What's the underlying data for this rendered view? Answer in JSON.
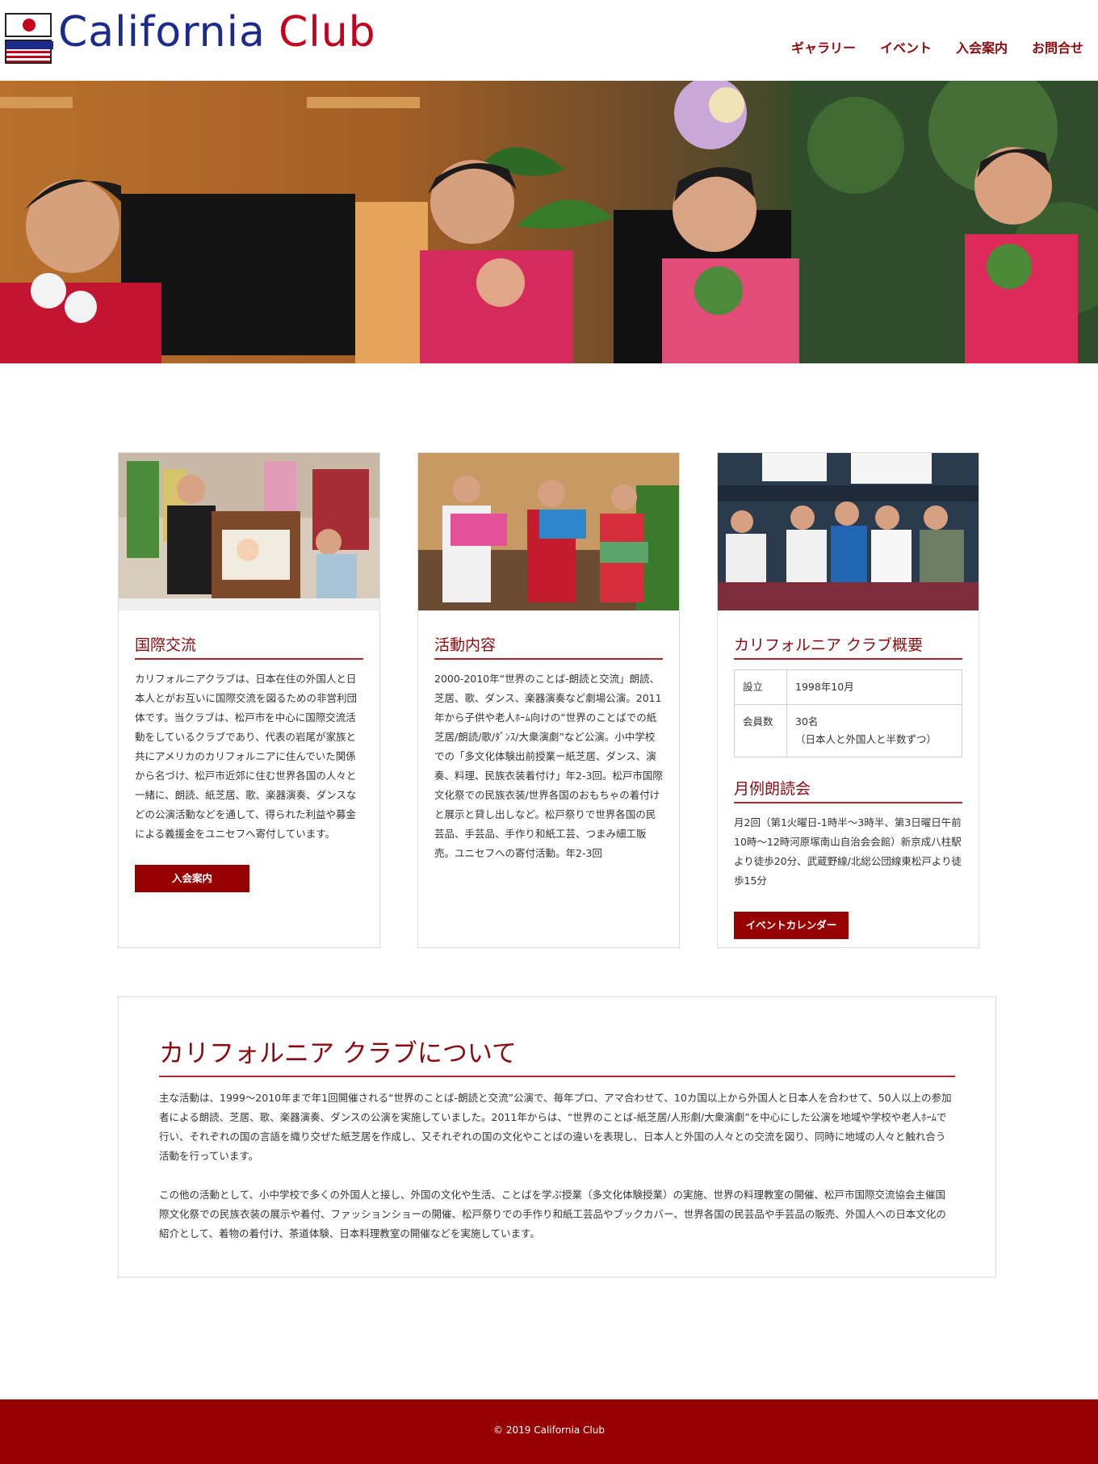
{
  "site": {
    "logo_text_1": "California",
    "logo_text_2": "Club"
  },
  "nav": {
    "items": [
      "ギャラリー",
      "イベント",
      "入会案内",
      "お問合せ"
    ]
  },
  "cards": {
    "exchange": {
      "title": "国際交流",
      "text": "カリフォルニアクラブは、日本在住の外国人と日本人とがお互いに国際交流を図るための非営利団体です。当クラブは、松戸市を中心に国際交流活動をしているクラブであり、代表の岩尾が家族と共にアメリカのカリフォルニアに住んでいた関係から名づけ、松戸市近郊に住む世界各国の人々と一緒に、朗読、紙芝居、歌、楽器演奏、ダンスなどの公演活動などを通して、得られた利益や募金による義援金をユニセフへ寄付しています。",
      "button": "入会案内"
    },
    "activity": {
      "title": "活動内容",
      "text": "2000-2010年“世界のことば-朗読と交流」朗読、芝居、歌、ダンス、楽器演奏など劇場公演。2011年から子供や老人ﾎｰﾑ向けの“世界のことばでの紙芝居/朗読/歌/ﾀﾞﾝｽ/大衆演劇”など公演。小中学校での「多文化体験出前授業ー紙芝居、ダンス、演奏、料理、民族衣装着付け」年2-3回。松戸市国際文化祭での民族衣装/世界各国のおもちゃの着付けと展示と貸し出しなど。松戸祭りで世界各国の民芸品、手芸品、手作り和紙工芸、つまみ細工販売。ユニセフへの寄付活動。年2-3回"
    },
    "overview": {
      "title": "カリフォルニア クラブ概要",
      "rows": [
        {
          "key": "設立",
          "value": "1998年10月",
          "value2": ""
        },
        {
          "key": "会員数",
          "value": "30名",
          "value2": "（日本人と外国人と半数ずつ）"
        }
      ],
      "reading_title": "月例朗読会",
      "reading_text": "月2回（第1火曜日-1時半〜3時半、第3日曜日午前10時〜12時河原塚南山自治会会館）新京成八柱駅より徒歩20分、武蔵野線/北総公団線東松戸より徒歩15分",
      "button": "イベントカレンダー"
    }
  },
  "about": {
    "title": "カリフォルニア クラブについて",
    "para1": "主な活動は、1999〜2010年まで年1回開催される“世界のことば-朗読と交流”公演で、毎年プロ、アマ合わせて、10カ国以上から外国人と日本人を合わせて、50人以上の参加者による朗読、芝居、歌、楽器演奏、ダンスの公演を実施していました。2011年からは、“世界のことば-紙芝居/人形劇/大衆演劇”を中心にした公演を地域や学校や老人ﾎｰﾑで行い、それぞれの国の言語を織り交ぜた紙芝居を作成し、又それぞれの国の文化やことばの違いを表現し、日本人と外国の人々との交流を図り、同時に地域の人々と触れ合う活動を行っています。",
    "para2": "この他の活動として、小中学校で多くの外国人と接し、外国の文化や生活、ことばを学ぶ授業（多文化体験授業）の実施、世界の料理教室の開催、松戸市国際交流協会主催国際文化祭での民族衣装の展示や着付、ファッションショーの開催、松戸祭りでの手作り和紙工芸品やブックカバー、世界各国の民芸品や手芸品の販売、外国人への日本文化の紹介として、着物の着付け、茶道体験、日本料理教室の開催などを実施しています。"
  },
  "footer": {
    "copyright": "© 2019 California Club"
  },
  "colors": {
    "accent": "#960000",
    "title": "#8b0a0f",
    "logo_blue": "#1c2a8c",
    "logo_red": "#c4001d"
  }
}
